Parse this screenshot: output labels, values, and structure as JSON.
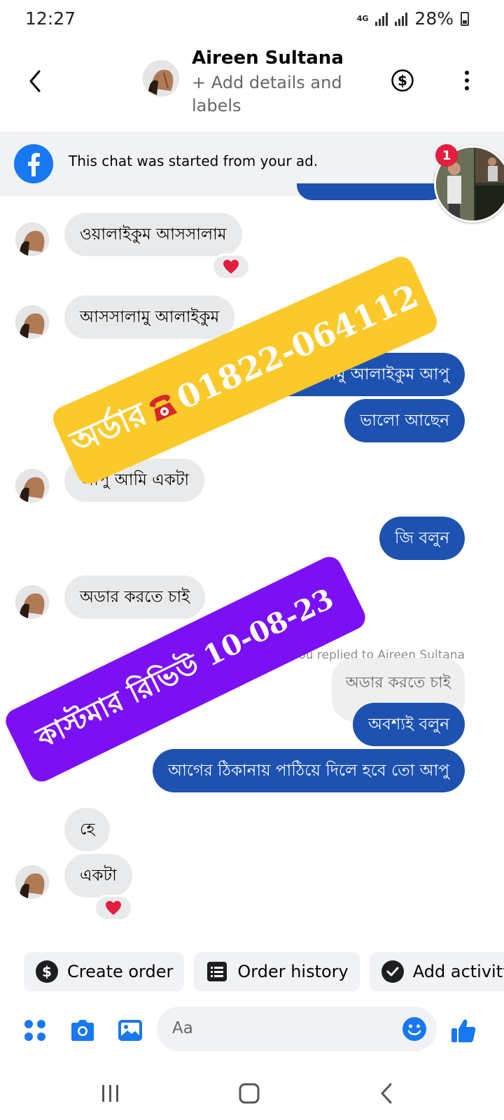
{
  "status_bar": {
    "time": "12:27",
    "network": "4G",
    "battery": "28%"
  },
  "header": {
    "contact_name": "Aireen Sultana",
    "subtitle": "+ Add details and labels"
  },
  "ad_banner": {
    "text": "This chat was started from your ad.",
    "badge_count": "1"
  },
  "messages": {
    "m1": "ওয়ালাইকুম আসসালাম",
    "m2": "আসসালামু আলাইকুম",
    "m3": "আসসালামু আলাইকুম আপু",
    "m4": "ভালো আছেন",
    "m5": "আপু আমি একটা",
    "m6": "জি বলুন",
    "m7": "অডার করতে চাই",
    "reply_note": "You replied to Aireen Sultana",
    "m8_quoted": "অডার করতে চাই",
    "m9": "অবশ্যই বলুন",
    "m10": "আগের ঠিকানায় পাঠিয়ে দিলে হবে তো আপু",
    "m11": "হে",
    "m12": "একটা"
  },
  "reactions": {
    "m1": "heart",
    "m12": "heart"
  },
  "overlays": {
    "yellow_left": "অর্ডার",
    "yellow_right": "01822-064112",
    "purple": "কাস্টমার রিভিউ  10-08-23"
  },
  "quick_actions": {
    "create_order": "Create order",
    "order_history": "Order history",
    "add_activity": "Add activity"
  },
  "composer": {
    "placeholder": "Aa"
  },
  "colors": {
    "outgoing_bubble": "#1d52b0",
    "incoming_bubble": "#e9eaec",
    "accent": "#1877f2",
    "yellow_banner": "#fcc92a",
    "purple_banner": "#7b10f5",
    "heart": "#e41e3f"
  }
}
